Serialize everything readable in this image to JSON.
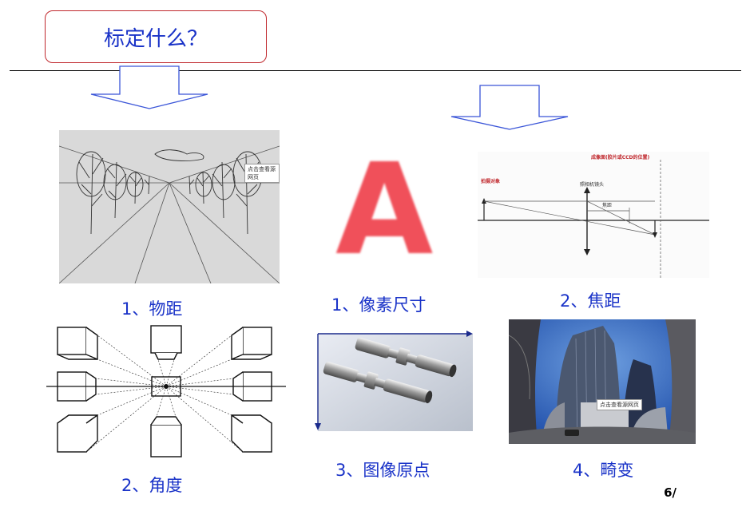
{
  "title": "标定什么？",
  "labels": {
    "object_distance": "1、物距",
    "angle": "2、角度",
    "pixel_size": "1、像素尺寸",
    "image_origin": "3、图像原点",
    "focal_length": "2、焦距",
    "distortion": "4、畸变"
  },
  "watermark": "点击查看源网页",
  "pixel_letter": "A",
  "lens_diagram": {
    "sensor_label": "成像面(胶片或CCD的位置)",
    "object_label": "拍摄对象",
    "lens_label": "照相机镜头",
    "focal_label": "焦距"
  },
  "page_number": "6/",
  "colors": {
    "title_text": "#1a33c8",
    "title_border": "#c0282d",
    "arrow_outline": "#3a55d8",
    "pixel_letter": "#f0505a"
  }
}
